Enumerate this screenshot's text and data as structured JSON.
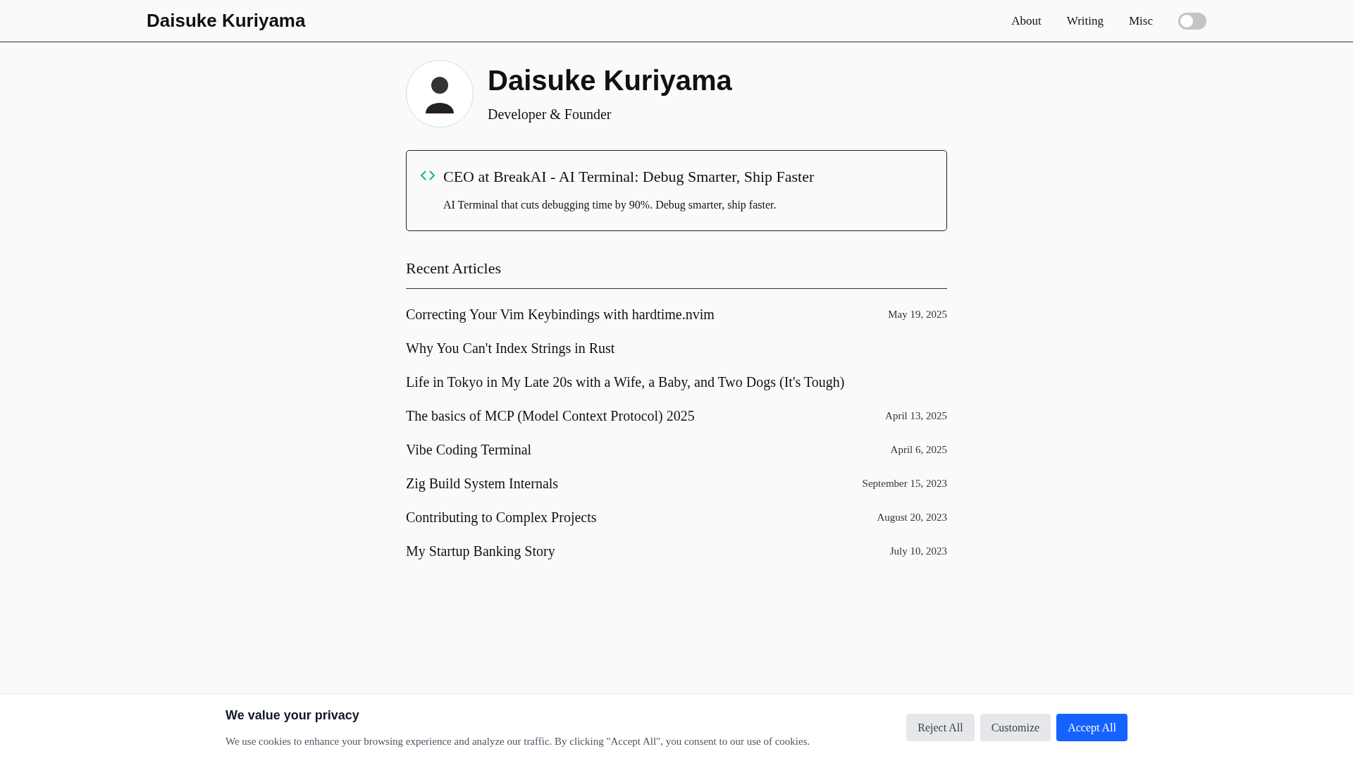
{
  "header": {
    "site_title": "Daisuke Kuriyama",
    "nav": [
      "About",
      "Writing",
      "Misc"
    ],
    "theme_toggle": {
      "on": false
    }
  },
  "profile": {
    "name": "Daisuke Kuriyama",
    "role": "Developer & Founder"
  },
  "project_card": {
    "title": "CEO at BreakAI - AI Terminal: Debug Smarter, Ship Faster",
    "description": "AI Terminal that cuts debugging time by 90%. Debug smarter, ship faster."
  },
  "recent_articles": {
    "heading": "Recent Articles",
    "items": [
      {
        "title": "Correcting Your Vim Keybindings with hardtime.nvim",
        "date": "May 19, 2025"
      },
      {
        "title": "Why You Can't Index Strings in Rust"
      },
      {
        "title": "Life in Tokyo in My Late 20s with a Wife, a Baby, and Two Dogs (It's Tough)"
      },
      {
        "title": "The basics of MCP (Model Context Protocol) 2025",
        "date": "April 13, 2025"
      },
      {
        "title": "Vibe Coding Terminal",
        "date": "April 6, 2025"
      },
      {
        "title": "Zig Build System Internals",
        "date": "September 15, 2023"
      },
      {
        "title": "Contributing to Complex Projects",
        "date": "August 20, 2023"
      },
      {
        "title": "My Startup Banking Story",
        "date": "July 10, 2023"
      }
    ]
  },
  "cookie_banner": {
    "title": "We value your privacy",
    "text": "We use cookies to enhance your browsing experience and analyze our traffic. By clicking \"Accept All\", you consent to our use of cookies.",
    "buttons": [
      {
        "label": "Reject All",
        "kind": "secondary"
      },
      {
        "label": "Customize",
        "kind": "secondary"
      },
      {
        "label": "Accept All",
        "kind": "primary"
      }
    ]
  }
}
